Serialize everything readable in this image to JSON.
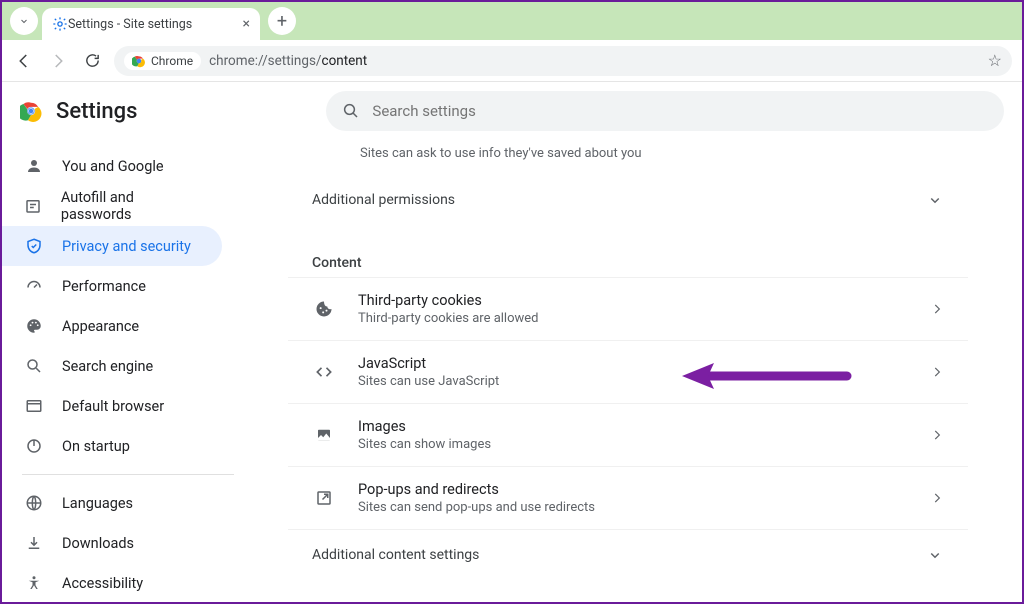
{
  "window": {
    "tab_title": "Settings - Site settings"
  },
  "omnibox": {
    "chip": "Chrome",
    "url_prefix": "chrome://settings/",
    "url_path": "content"
  },
  "header": {
    "title": "Settings",
    "search_placeholder": "Search settings"
  },
  "sidebar": {
    "items": [
      {
        "key": "you",
        "label": "You and Google"
      },
      {
        "key": "autofill",
        "label": "Autofill and passwords"
      },
      {
        "key": "privacy",
        "label": "Privacy and security"
      },
      {
        "key": "perf",
        "label": "Performance"
      },
      {
        "key": "appearance",
        "label": "Appearance"
      },
      {
        "key": "search",
        "label": "Search engine"
      },
      {
        "key": "default",
        "label": "Default browser"
      },
      {
        "key": "startup",
        "label": "On startup"
      }
    ],
    "secondary": [
      {
        "key": "languages",
        "label": "Languages"
      },
      {
        "key": "downloads",
        "label": "Downloads"
      },
      {
        "key": "a11y",
        "label": "Accessibility"
      }
    ]
  },
  "content": {
    "prev_row_desc": "Sites can ask to use info they've saved about you",
    "expander1": "Additional permissions",
    "section": "Content",
    "rows": [
      {
        "title": "Third-party cookies",
        "desc": "Third-party cookies are allowed"
      },
      {
        "title": "JavaScript",
        "desc": "Sites can use JavaScript"
      },
      {
        "title": "Images",
        "desc": "Sites can show images"
      },
      {
        "title": "Pop-ups and redirects",
        "desc": "Sites can send pop-ups and use redirects"
      }
    ],
    "expander2": "Additional content settings"
  }
}
